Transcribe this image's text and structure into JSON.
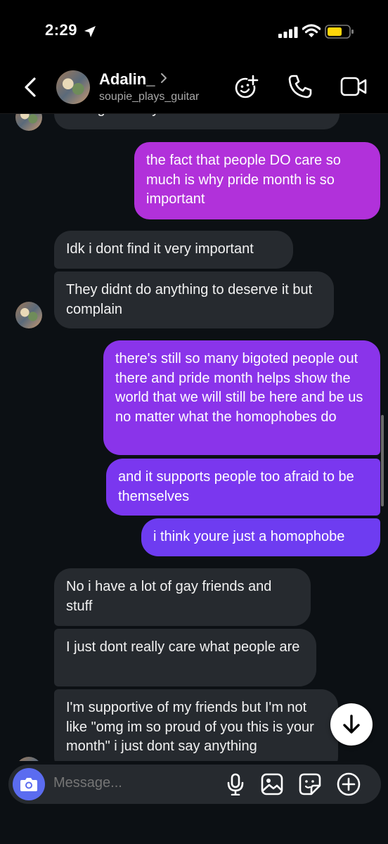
{
  "status": {
    "time": "2:29"
  },
  "header": {
    "name": "Adalin_",
    "username": "soupie_plays_guitar"
  },
  "messages": [
    {
      "from": "them",
      "text": "be a girl or boy"
    },
    {
      "from": "me",
      "text": "the fact that people DO care so much is why pride month is so important"
    },
    {
      "from": "them",
      "text": "Idk i dont find it very important"
    },
    {
      "from": "them",
      "text": "They didnt do anything to deserve it but complain"
    },
    {
      "from": "me",
      "text": "there's still so many bigoted people out there and pride month helps show the world that we will still be here and be us no matter what the homophobes do"
    },
    {
      "from": "me",
      "text": "and it supports people too afraid to be themselves"
    },
    {
      "from": "me",
      "text": "i think youre just a homophobe"
    },
    {
      "from": "them",
      "text": "No i have a lot of gay friends and stuff"
    },
    {
      "from": "them",
      "text": "I just dont really care what people are"
    },
    {
      "from": "them",
      "text": "I'm supportive of my friends but I'm not like \"omg im so proud of you this is your month\" i just dont say anything"
    }
  ],
  "composer": {
    "placeholder": "Message..."
  },
  "colors": {
    "sent_top": "#b52fd6",
    "sent_bottom": "#6d3cf0",
    "received": "#262a2f",
    "camera": "#5b6cf0"
  }
}
